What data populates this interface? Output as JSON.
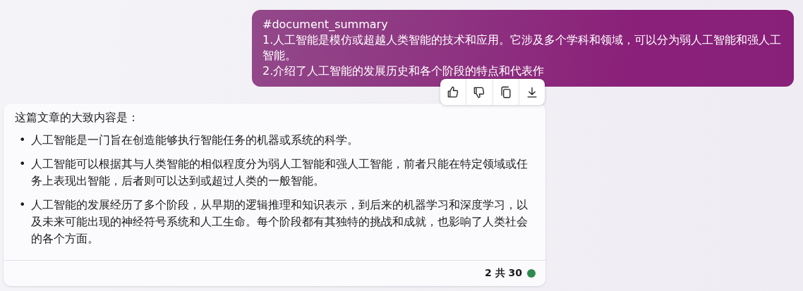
{
  "user_message": {
    "lines": [
      "#document_summary",
      "1.人工智能是模仿或超越人类智能的技术和应用。它涉及多个学科和领域，可以分为弱人工智能和强人工智能。",
      "2.介绍了人工智能的发展历史和各个阶段的特点和代表作"
    ]
  },
  "message_actions": [
    {
      "kind": "like"
    },
    {
      "kind": "dislike"
    },
    {
      "kind": "copy"
    },
    {
      "kind": "download"
    }
  ],
  "bot_message": {
    "intro": "这篇文章的大致内容是：",
    "bullets": [
      {
        "marker": "•",
        "text": "人工智能是一门旨在创造能够执行智能任务的机器或系统的科学。"
      },
      {
        "marker": "•",
        "text": "人工智能可以根据其与人类智能的相似程度分为弱人工智能和强人工智能，前者只能在特定领域或任务上表现出智能，后者则可以达到或超过人类的一般智能。"
      },
      {
        "marker": "•",
        "text": "人工智能的发展经历了多个阶段，从早期的逻辑推理和知识表示，到后来的机器学习和深度学习，以及未来可能出现的神经符号系统和人工生命。每个阶段都有其独特的挑战和成就，也影响了人类社会的各个方面。"
      }
    ],
    "footer": {
      "counter": "2 共 30"
    }
  }
}
